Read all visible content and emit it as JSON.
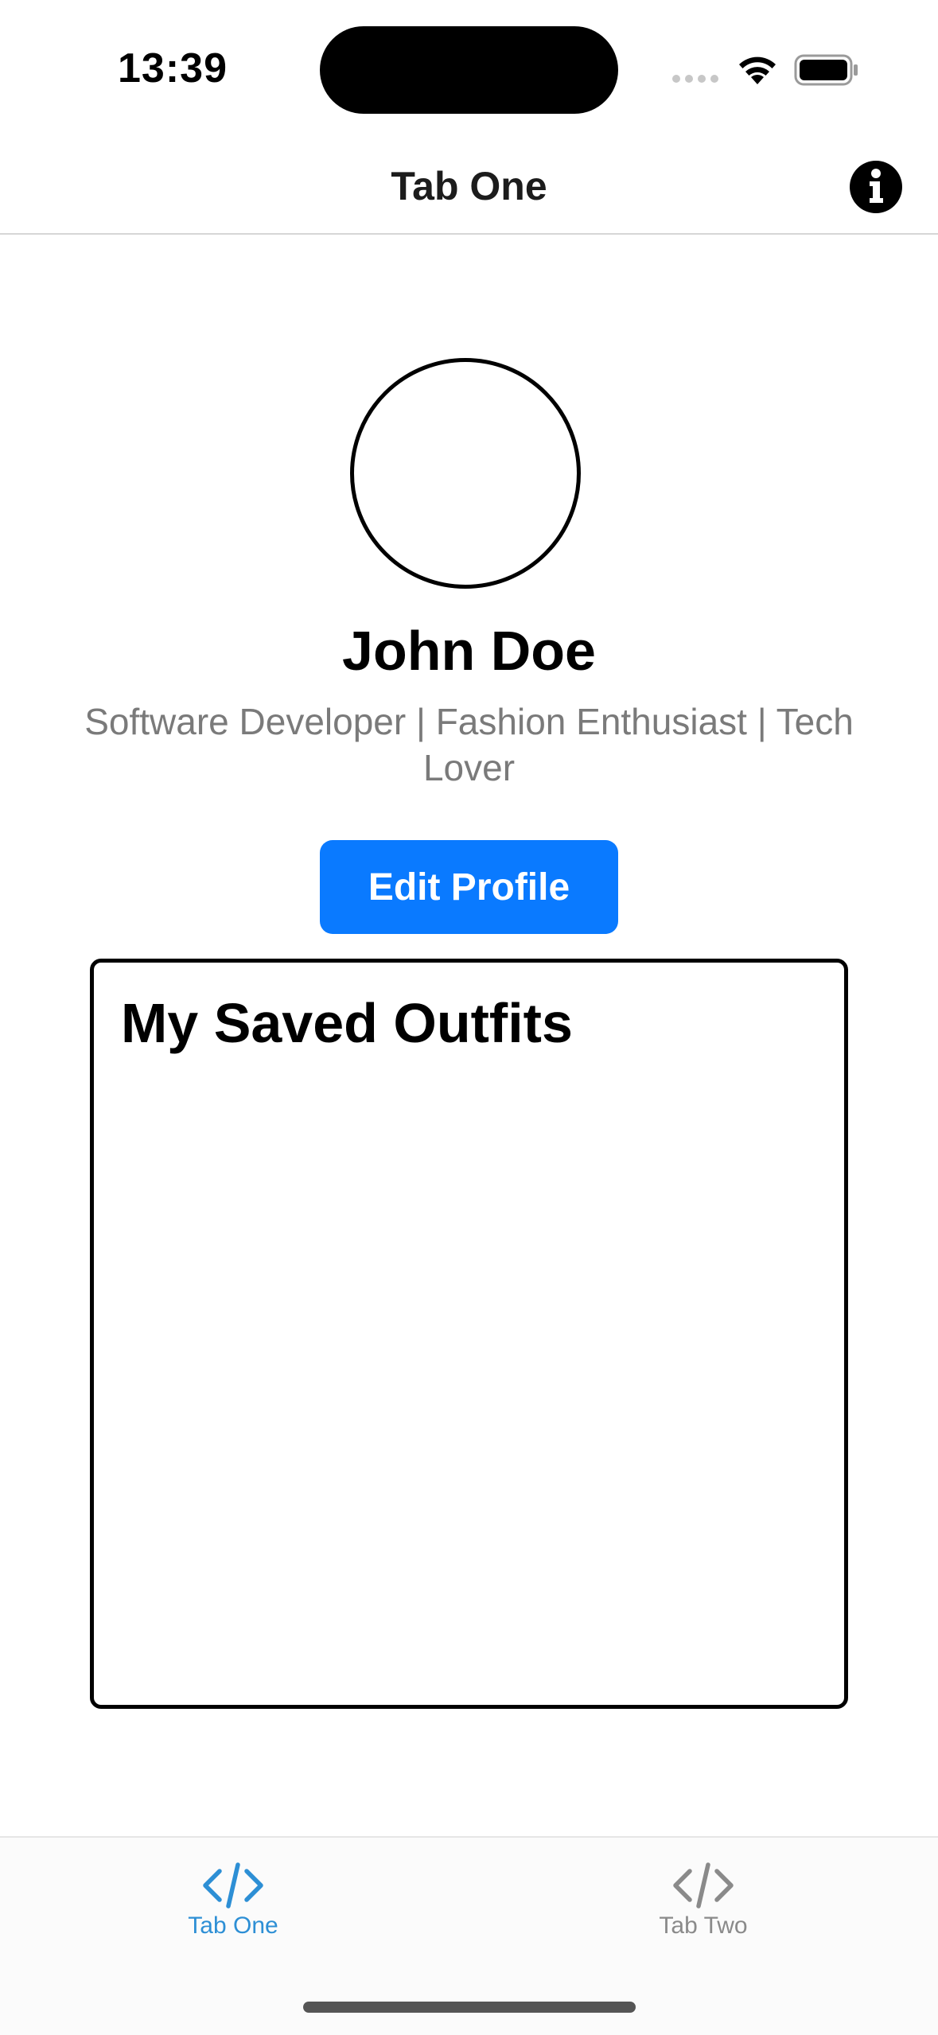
{
  "status_bar": {
    "time": "13:39"
  },
  "nav": {
    "title": "Tab One",
    "info_icon": "info-circle-icon"
  },
  "profile": {
    "name": "John Doe",
    "bio": "Software Developer | Fashion Enthusiast | Tech Lover",
    "edit_button_label": "Edit Profile"
  },
  "outfits": {
    "title": "My Saved Outfits"
  },
  "tabs": [
    {
      "label": "Tab One",
      "icon": "code-icon",
      "selected": true
    },
    {
      "label": "Tab Two",
      "icon": "code-icon",
      "selected": false
    }
  ],
  "colors": {
    "accent": "#0a7aff",
    "tab_active": "#2d8fd5",
    "tab_inactive": "#8a8a8a",
    "secondary_text": "#7a7a7a"
  }
}
